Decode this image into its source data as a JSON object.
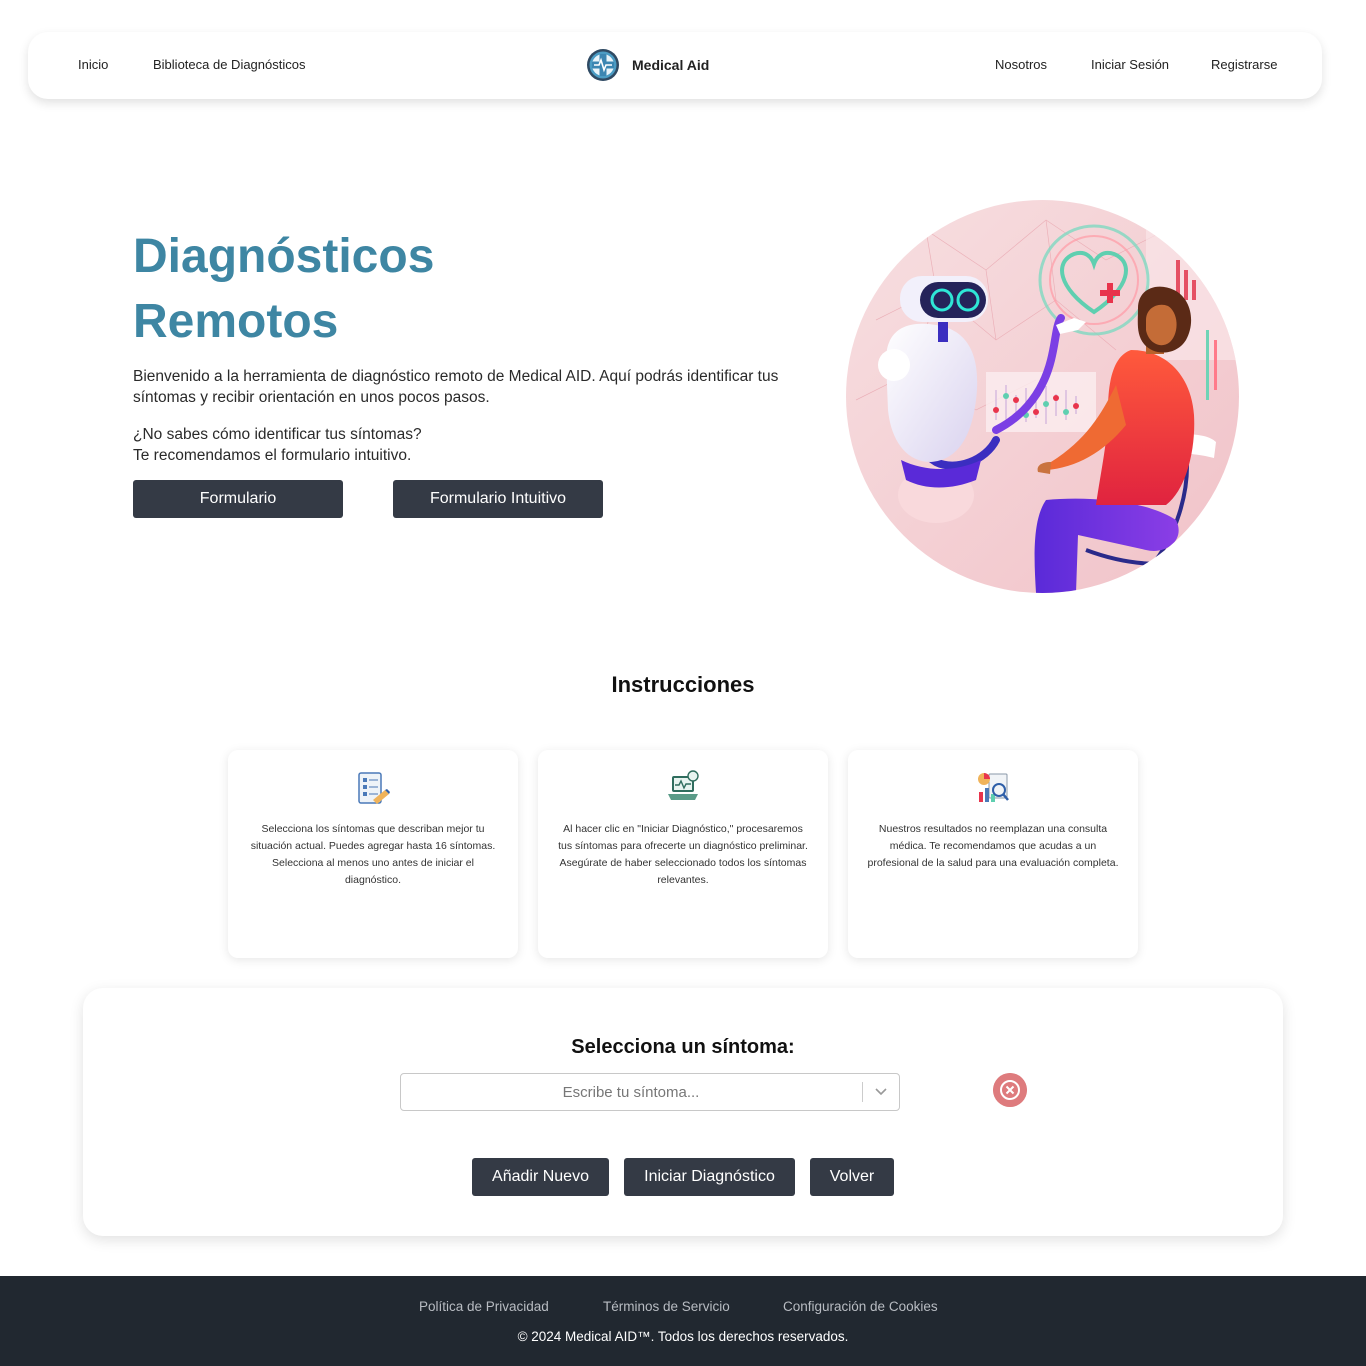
{
  "nav": {
    "left": [
      "Inicio",
      "Biblioteca de Diagnósticos"
    ],
    "brand": "Medical Aid",
    "right": [
      "Nosotros",
      "Iniciar Sesión",
      "Registrarse"
    ]
  },
  "hero": {
    "title_line1": "Diagnósticos",
    "title_line2": "Remotos",
    "intro": "Bienvenido a la herramienta de diagnóstico remoto de Medical AID. Aquí podrás identificar tus síntomas y recibir orientación en unos pocos pasos.",
    "question": "¿No sabes cómo identificar tus síntomas?",
    "recommendation": "Te recomendamos el formulario intuitivo.",
    "buttons": [
      "Formulario",
      "Formulario Intuitivo"
    ]
  },
  "instructions": {
    "title": "Instrucciones",
    "cards": [
      {
        "icon": "checklist-icon",
        "text": "Selecciona los síntomas que describan mejor tu situación actual. Puedes agregar hasta 16 síntomas. Selecciona al menos uno antes de iniciar el diagnóstico."
      },
      {
        "icon": "laptop-diagnosis-icon",
        "text": "Al hacer clic en \"Iniciar Diagnóstico,\" procesaremos tus síntomas para ofrecerte un diagnóstico preliminar. Asegúrate de haber seleccionado todos los síntomas relevantes."
      },
      {
        "icon": "analytics-report-icon",
        "text": "Nuestros resultados no reemplazan una consulta médica. Te recomendamos que acudas a un profesional de la salud para una evaluación completa."
      }
    ]
  },
  "symptom_panel": {
    "title": "Selecciona un síntoma:",
    "placeholder": "Escribe tu síntoma...",
    "buttons": [
      "Añadir Nuevo",
      "Iniciar Diagnóstico",
      "Volver"
    ]
  },
  "footer": {
    "links": [
      "Política de Privacidad",
      "Términos de Servicio",
      "Configuración de Cookies"
    ],
    "copyright": "© 2024 Medical AID™. Todos los derechos reservados."
  },
  "colors": {
    "accent": "#3e86a3",
    "button": "#343a45",
    "footer": "#212830",
    "remove": "#de7b7d"
  }
}
